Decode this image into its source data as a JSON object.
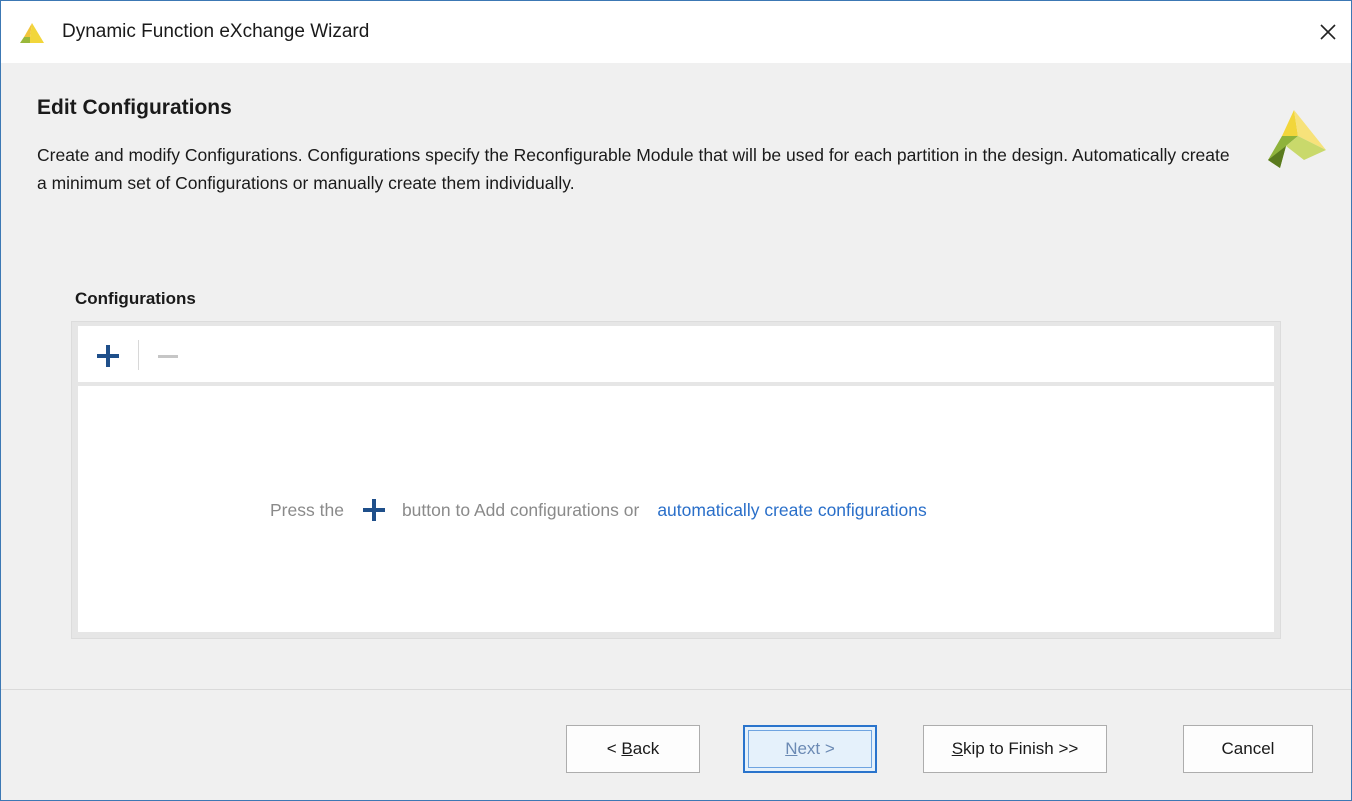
{
  "window": {
    "title": "Dynamic Function eXchange Wizard",
    "close_glyph": "✕",
    "logo_icon": "xilinx-logo-icon"
  },
  "header": {
    "title": "Edit Configurations",
    "description": "Create and modify Configurations. Configurations specify the Reconfigurable Module that will be used for each partition in the design. Automatically create a minimum set of Configurations or manually create them individually.",
    "brand_icon": "xilinx-logo-icon"
  },
  "configurations": {
    "label": "Configurations",
    "toolbar": {
      "add_icon": "plus-icon",
      "remove_icon": "minus-icon"
    },
    "empty_message": {
      "pre": "Press the",
      "post": "button to Add configurations or",
      "link": "automatically create configurations"
    }
  },
  "buttons": {
    "back": {
      "prefix": "< ",
      "mnemonic": "B",
      "rest": "ack"
    },
    "next": {
      "mnemonic": "N",
      "rest": "ext >"
    },
    "skip": {
      "mnemonic": "S",
      "rest": "kip to Finish >>"
    },
    "cancel": "Cancel"
  },
  "colors": {
    "accent_blue": "#2a74cc",
    "link_blue": "#2a6fc9",
    "plus_blue": "#1f4f8a",
    "logo_yellow": "#f2d63b",
    "logo_green": "#8fb33b",
    "logo_dark": "#5a7a1e"
  }
}
